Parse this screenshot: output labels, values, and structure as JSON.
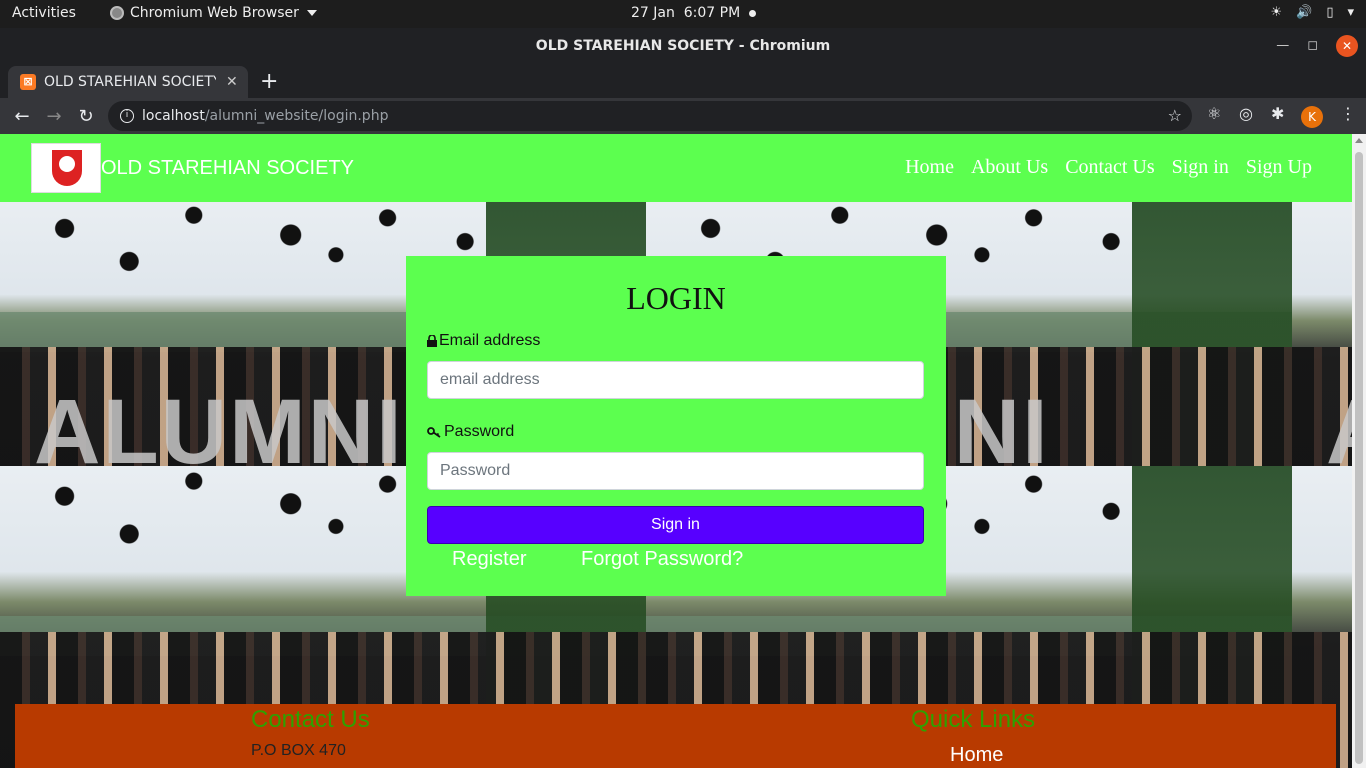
{
  "system_bar": {
    "activities": "Activities",
    "app_name": "Chromium Web Browser",
    "date": "27 Jan",
    "time": "6:07 PM"
  },
  "browser": {
    "window_title": "OLD STAREHIAN SOCIETY - Chromium",
    "tab_title": "OLD STAREHIAN SOCIETY",
    "url_host": "localhost",
    "url_path": "/alumni_website/login.php",
    "profile_initial": "K"
  },
  "site": {
    "brand": "OLD STAREHIAN SOCIETY",
    "nav": [
      "Home",
      "About Us",
      "Contact Us",
      "Sign in",
      "Sign Up"
    ],
    "hero_text": "ALUMNI"
  },
  "login": {
    "title": "LOGIN",
    "email_label": "Email address",
    "email_placeholder": "email address",
    "password_label": "Password",
    "password_placeholder": "Password",
    "submit": "Sign in",
    "register": "Register",
    "forgot": "Forgot Password?"
  },
  "footer": {
    "contact_heading": "Contact Us",
    "address": "P.O BOX 470",
    "links_heading": "Quick Links",
    "links": [
      "Home"
    ]
  },
  "colors": {
    "navbar": "#5cff4f",
    "card": "#5cff4f",
    "button": "#5700ff",
    "footer": "#b83a00",
    "footer_heading": "#2ea100"
  }
}
